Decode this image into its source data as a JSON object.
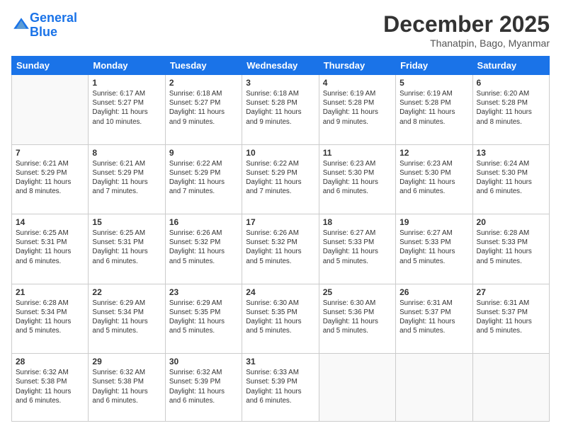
{
  "header": {
    "logo_line1": "General",
    "logo_line2": "Blue",
    "month": "December 2025",
    "location": "Thanatpin, Bago, Myanmar"
  },
  "weekdays": [
    "Sunday",
    "Monday",
    "Tuesday",
    "Wednesday",
    "Thursday",
    "Friday",
    "Saturday"
  ],
  "weeks": [
    [
      {
        "day": "",
        "info": ""
      },
      {
        "day": "1",
        "info": "Sunrise: 6:17 AM\nSunset: 5:27 PM\nDaylight: 11 hours\nand 10 minutes."
      },
      {
        "day": "2",
        "info": "Sunrise: 6:18 AM\nSunset: 5:27 PM\nDaylight: 11 hours\nand 9 minutes."
      },
      {
        "day": "3",
        "info": "Sunrise: 6:18 AM\nSunset: 5:28 PM\nDaylight: 11 hours\nand 9 minutes."
      },
      {
        "day": "4",
        "info": "Sunrise: 6:19 AM\nSunset: 5:28 PM\nDaylight: 11 hours\nand 9 minutes."
      },
      {
        "day": "5",
        "info": "Sunrise: 6:19 AM\nSunset: 5:28 PM\nDaylight: 11 hours\nand 8 minutes."
      },
      {
        "day": "6",
        "info": "Sunrise: 6:20 AM\nSunset: 5:28 PM\nDaylight: 11 hours\nand 8 minutes."
      }
    ],
    [
      {
        "day": "7",
        "info": "Sunrise: 6:21 AM\nSunset: 5:29 PM\nDaylight: 11 hours\nand 8 minutes."
      },
      {
        "day": "8",
        "info": "Sunrise: 6:21 AM\nSunset: 5:29 PM\nDaylight: 11 hours\nand 7 minutes."
      },
      {
        "day": "9",
        "info": "Sunrise: 6:22 AM\nSunset: 5:29 PM\nDaylight: 11 hours\nand 7 minutes."
      },
      {
        "day": "10",
        "info": "Sunrise: 6:22 AM\nSunset: 5:29 PM\nDaylight: 11 hours\nand 7 minutes."
      },
      {
        "day": "11",
        "info": "Sunrise: 6:23 AM\nSunset: 5:30 PM\nDaylight: 11 hours\nand 6 minutes."
      },
      {
        "day": "12",
        "info": "Sunrise: 6:23 AM\nSunset: 5:30 PM\nDaylight: 11 hours\nand 6 minutes."
      },
      {
        "day": "13",
        "info": "Sunrise: 6:24 AM\nSunset: 5:30 PM\nDaylight: 11 hours\nand 6 minutes."
      }
    ],
    [
      {
        "day": "14",
        "info": "Sunrise: 6:25 AM\nSunset: 5:31 PM\nDaylight: 11 hours\nand 6 minutes."
      },
      {
        "day": "15",
        "info": "Sunrise: 6:25 AM\nSunset: 5:31 PM\nDaylight: 11 hours\nand 6 minutes."
      },
      {
        "day": "16",
        "info": "Sunrise: 6:26 AM\nSunset: 5:32 PM\nDaylight: 11 hours\nand 5 minutes."
      },
      {
        "day": "17",
        "info": "Sunrise: 6:26 AM\nSunset: 5:32 PM\nDaylight: 11 hours\nand 5 minutes."
      },
      {
        "day": "18",
        "info": "Sunrise: 6:27 AM\nSunset: 5:33 PM\nDaylight: 11 hours\nand 5 minutes."
      },
      {
        "day": "19",
        "info": "Sunrise: 6:27 AM\nSunset: 5:33 PM\nDaylight: 11 hours\nand 5 minutes."
      },
      {
        "day": "20",
        "info": "Sunrise: 6:28 AM\nSunset: 5:33 PM\nDaylight: 11 hours\nand 5 minutes."
      }
    ],
    [
      {
        "day": "21",
        "info": "Sunrise: 6:28 AM\nSunset: 5:34 PM\nDaylight: 11 hours\nand 5 minutes."
      },
      {
        "day": "22",
        "info": "Sunrise: 6:29 AM\nSunset: 5:34 PM\nDaylight: 11 hours\nand 5 minutes."
      },
      {
        "day": "23",
        "info": "Sunrise: 6:29 AM\nSunset: 5:35 PM\nDaylight: 11 hours\nand 5 minutes."
      },
      {
        "day": "24",
        "info": "Sunrise: 6:30 AM\nSunset: 5:35 PM\nDaylight: 11 hours\nand 5 minutes."
      },
      {
        "day": "25",
        "info": "Sunrise: 6:30 AM\nSunset: 5:36 PM\nDaylight: 11 hours\nand 5 minutes."
      },
      {
        "day": "26",
        "info": "Sunrise: 6:31 AM\nSunset: 5:37 PM\nDaylight: 11 hours\nand 5 minutes."
      },
      {
        "day": "27",
        "info": "Sunrise: 6:31 AM\nSunset: 5:37 PM\nDaylight: 11 hours\nand 5 minutes."
      }
    ],
    [
      {
        "day": "28",
        "info": "Sunrise: 6:32 AM\nSunset: 5:38 PM\nDaylight: 11 hours\nand 6 minutes."
      },
      {
        "day": "29",
        "info": "Sunrise: 6:32 AM\nSunset: 5:38 PM\nDaylight: 11 hours\nand 6 minutes."
      },
      {
        "day": "30",
        "info": "Sunrise: 6:32 AM\nSunset: 5:39 PM\nDaylight: 11 hours\nand 6 minutes."
      },
      {
        "day": "31",
        "info": "Sunrise: 6:33 AM\nSunset: 5:39 PM\nDaylight: 11 hours\nand 6 minutes."
      },
      {
        "day": "",
        "info": ""
      },
      {
        "day": "",
        "info": ""
      },
      {
        "day": "",
        "info": ""
      }
    ]
  ]
}
